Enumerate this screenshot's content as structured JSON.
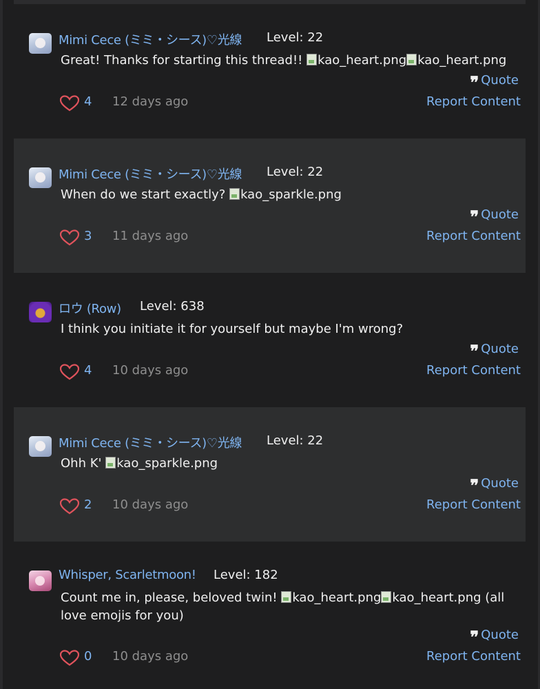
{
  "posts": [
    {
      "username": "Mimi Cece (ミミ・シース)♡光線",
      "level": "Level: 22",
      "avatar": "mimi-cece-avatar",
      "text": "Great! Thanks for starting this thread!! ",
      "images": [
        "kao_heart.png",
        "kao_heart.png"
      ],
      "text_after": "",
      "likes": "4",
      "time": "12 days ago",
      "quote_label": "Quote",
      "report_label": "Report Content"
    },
    {
      "username": "Mimi Cece (ミミ・シース)♡光線",
      "level": "Level: 22",
      "avatar": "mimi-cece-avatar",
      "text": "When do we start exactly? ",
      "images": [
        "kao_sparkle.png"
      ],
      "text_after": "",
      "likes": "3",
      "time": "11 days ago",
      "quote_label": "Quote",
      "report_label": "Report Content"
    },
    {
      "username": "ロウ (Row)",
      "level": "Level: 638",
      "avatar": "row-avatar",
      "text": "I think you initiate it for yourself but maybe I'm wrong?",
      "images": [],
      "text_after": "",
      "likes": "4",
      "time": "10 days ago",
      "quote_label": "Quote",
      "report_label": "Report Content"
    },
    {
      "username": "Mimi Cece (ミミ・シース)♡光線",
      "level": "Level: 22",
      "avatar": "mimi-cece-avatar",
      "text": "Ohh K' ",
      "images": [
        "kao_sparkle.png"
      ],
      "text_after": "",
      "likes": "2",
      "time": "10 days ago",
      "quote_label": "Quote",
      "report_label": "Report Content"
    },
    {
      "username": "Whisper, Scarletmoon!",
      "level": "Level: 182",
      "avatar": "whisper-avatar",
      "text": "Count me in, please, beloved twin! ",
      "images": [
        "kao_heart.png",
        "kao_heart.png"
      ],
      "text_after": " (all love emojis for you)",
      "likes": "0",
      "time": "10 days ago",
      "quote_label": "Quote",
      "report_label": "Report Content"
    }
  ],
  "colors": {
    "background": "#1e1e1f",
    "shaded_post": "#2d2e2f",
    "link": "#7fb4f0",
    "heart": "#e0535c",
    "muted": "#8e8e8e"
  }
}
